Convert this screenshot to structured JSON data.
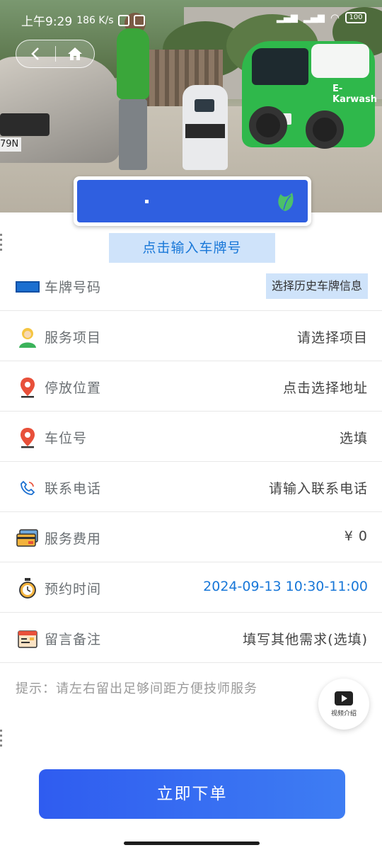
{
  "status_bar": {
    "time": "上午9:29",
    "speed": "186 K/s",
    "battery": "100"
  },
  "nav": {
    "back_icon": "chevron-left-icon",
    "home_icon": "home-icon"
  },
  "hero": {
    "brand_text": "E-Karwash",
    "car_plate_fragment": "79N"
  },
  "plate": {
    "display_text": "",
    "input_prompt": "点击输入车牌号"
  },
  "form": {
    "rows": [
      {
        "label": "车牌号码",
        "value": "选择历史车牌信息",
        "icon": "plate-icon"
      },
      {
        "label": "服务项目",
        "value": "请选择项目",
        "icon": "worker-icon"
      },
      {
        "label": "停放位置",
        "value": "点击选择地址",
        "icon": "location-pin-icon"
      },
      {
        "label": "车位号",
        "value": "选填",
        "icon": "location-pin-icon"
      },
      {
        "label": "联系电话",
        "value": "请输入联系电话",
        "icon": "phone-icon"
      },
      {
        "label": "服务费用",
        "value": "¥ 0",
        "icon": "card-icon"
      },
      {
        "label": "预约时间",
        "value": "2024-09-13 10:30-11:00",
        "icon": "stopwatch-icon"
      },
      {
        "label": "留言备注",
        "value": "填写其他需求(选填)",
        "icon": "calendar-note-icon"
      }
    ]
  },
  "tip": "提示：请左右留出足够间距方便技师服务",
  "video_button": {
    "label": "视频介绍"
  },
  "submit": {
    "label": "立即下单"
  },
  "colors": {
    "accent": "#2f5fe0",
    "link": "#1877d8",
    "light_blue_bg": "#cfe3fa"
  }
}
